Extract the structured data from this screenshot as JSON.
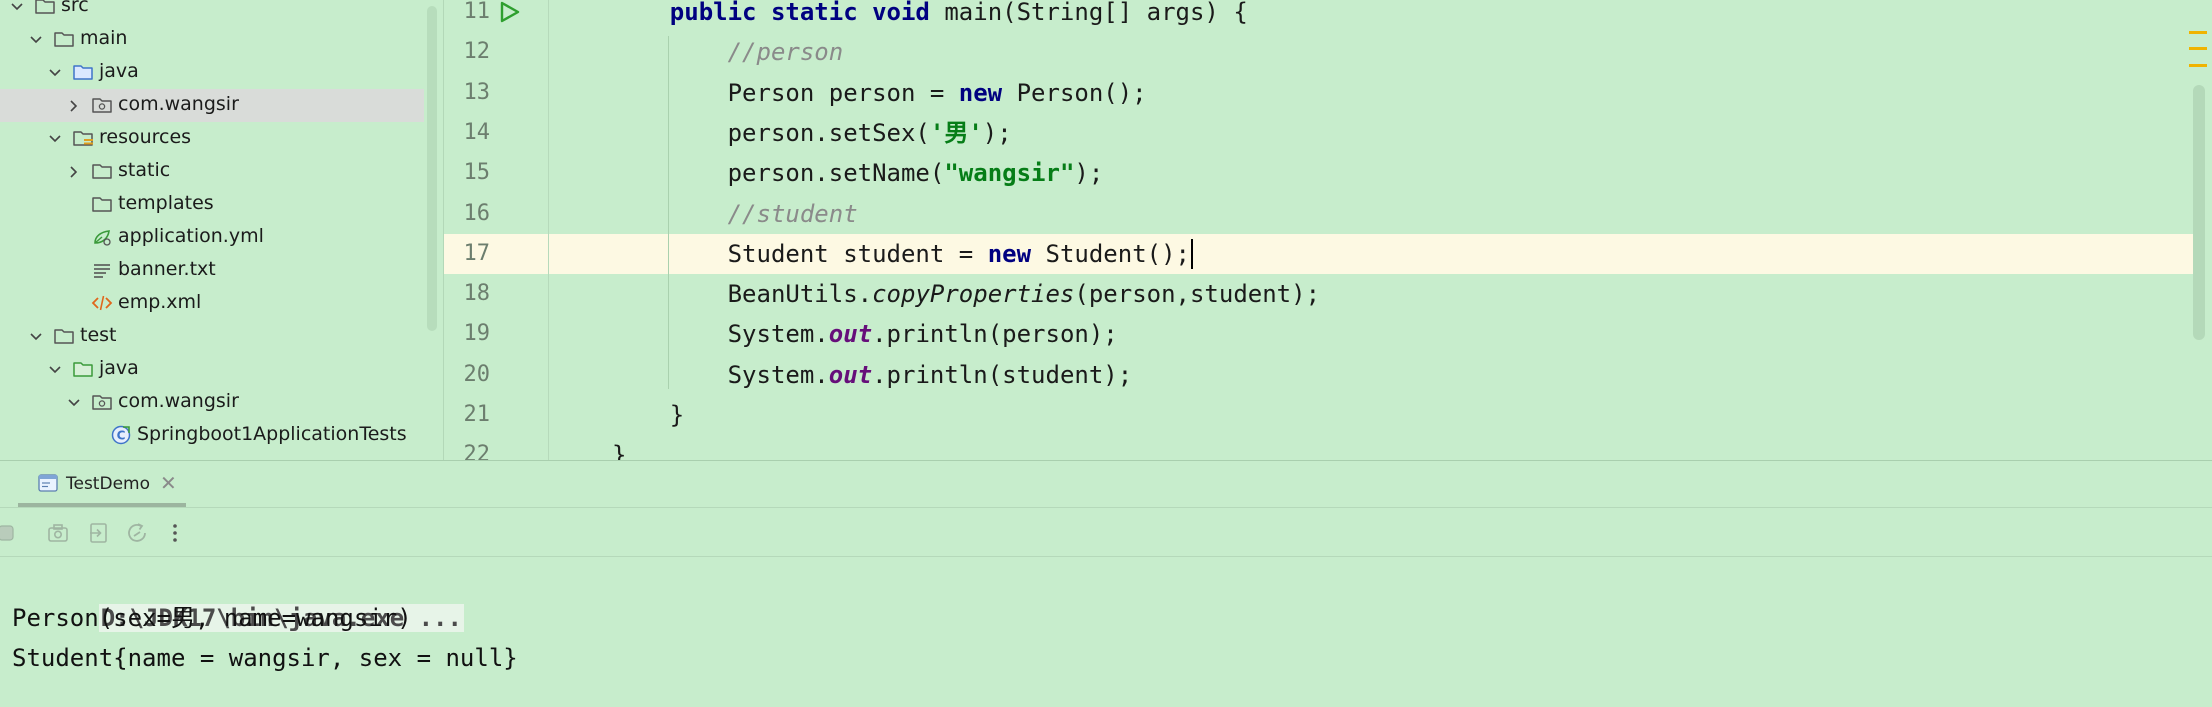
{
  "project_tree": {
    "items": [
      {
        "label": "src",
        "type": "folder",
        "expanded": true
      },
      {
        "label": "main",
        "type": "folder",
        "expanded": true
      },
      {
        "label": "java",
        "type": "source-folder",
        "expanded": true
      },
      {
        "label": "com.wangsir",
        "type": "package",
        "expanded": false,
        "selected": true
      },
      {
        "label": "resources",
        "type": "resources-folder",
        "expanded": true
      },
      {
        "label": "static",
        "type": "folder",
        "expanded": false
      },
      {
        "label": "templates",
        "type": "folder"
      },
      {
        "label": "application.yml",
        "type": "yml-file"
      },
      {
        "label": "banner.txt",
        "type": "text-file"
      },
      {
        "label": "emp.xml",
        "type": "xml-file"
      },
      {
        "label": "test",
        "type": "folder",
        "expanded": true
      },
      {
        "label": "java",
        "type": "test-source-folder",
        "expanded": true
      },
      {
        "label": "com.wangsir",
        "type": "package",
        "expanded": true
      },
      {
        "label": "Springboot1ApplicationTests",
        "type": "test-class"
      }
    ]
  },
  "editor": {
    "lines": [
      {
        "number": "11",
        "tokens": [
          {
            "t": "    ",
            "c": ""
          },
          {
            "t": "public static void",
            "c": "kw"
          },
          {
            "t": " main(String[] args) {",
            "c": ""
          }
        ]
      },
      {
        "number": "12",
        "tokens": [
          {
            "t": "        ",
            "c": ""
          },
          {
            "t": "//person",
            "c": "cm"
          }
        ]
      },
      {
        "number": "13",
        "tokens": [
          {
            "t": "        Person person = ",
            "c": ""
          },
          {
            "t": "new",
            "c": "kw"
          },
          {
            "t": " Person();",
            "c": ""
          }
        ]
      },
      {
        "number": "14",
        "tokens": [
          {
            "t": "        person.setSex(",
            "c": ""
          },
          {
            "t": "'男'",
            "c": "str"
          },
          {
            "t": ");",
            "c": ""
          }
        ]
      },
      {
        "number": "15",
        "tokens": [
          {
            "t": "        person.setName(",
            "c": ""
          },
          {
            "t": "\"wangsir\"",
            "c": "str"
          },
          {
            "t": ");",
            "c": ""
          }
        ]
      },
      {
        "number": "16",
        "tokens": [
          {
            "t": "        ",
            "c": ""
          },
          {
            "t": "//student",
            "c": "cm"
          }
        ]
      },
      {
        "number": "17",
        "tokens": [
          {
            "t": "        Student student = ",
            "c": ""
          },
          {
            "t": "new",
            "c": "kw"
          },
          {
            "t": " Student();",
            "c": ""
          }
        ]
      },
      {
        "number": "18",
        "tokens": [
          {
            "t": "        BeanUtils.",
            "c": ""
          },
          {
            "t": "copyProperties",
            "c": "it"
          },
          {
            "t": "(person,student);",
            "c": ""
          }
        ]
      },
      {
        "number": "19",
        "tokens": [
          {
            "t": "        System.",
            "c": ""
          },
          {
            "t": "out",
            "c": "fld"
          },
          {
            "t": ".println(person);",
            "c": ""
          }
        ]
      },
      {
        "number": "20",
        "tokens": [
          {
            "t": "        System.",
            "c": ""
          },
          {
            "t": "out",
            "c": "fld"
          },
          {
            "t": ".println(student);",
            "c": ""
          }
        ]
      },
      {
        "number": "21",
        "tokens": [
          {
            "t": "    }",
            "c": ""
          }
        ]
      },
      {
        "number": "22",
        "tokens": [
          {
            "t": "}",
            "c": ""
          }
        ]
      }
    ],
    "current_line_number": "17"
  },
  "run_panel": {
    "tab_label": "TestDemo",
    "tab_close": "✕",
    "console": {
      "command": "D:\\JDK17\\bin\\java.exe ...",
      "output": [
        "Person(sex=男, name=wangsir)",
        "Student{name = wangsir, sex = null}"
      ]
    }
  },
  "colors": {
    "background": "#C7EDCC",
    "current_line": "#FDF9E3",
    "keyword": "#000080",
    "string": "#067D17",
    "comment": "#8A8A8A",
    "field": "#660E7A",
    "run_icon": "#2E9F2E",
    "marker": "#F0B400"
  }
}
